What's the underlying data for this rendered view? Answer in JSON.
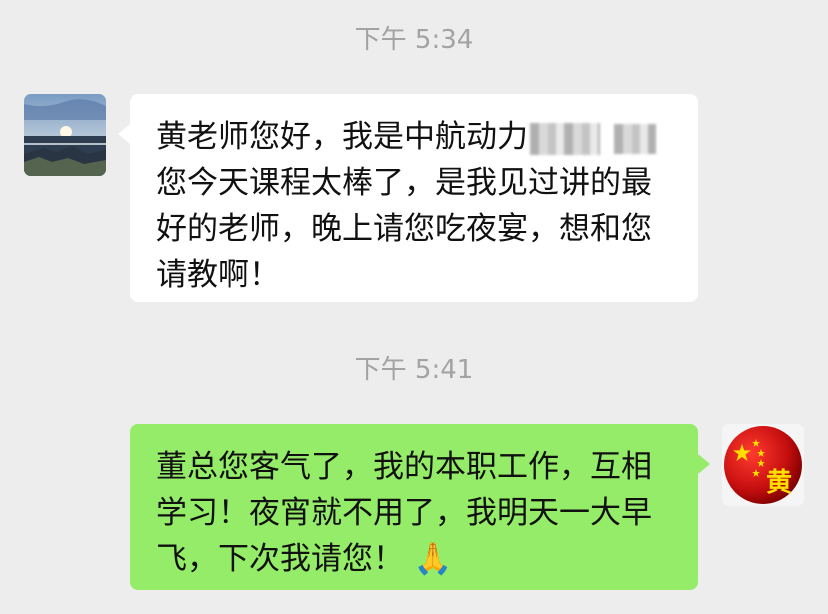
{
  "conversation": {
    "timestamps": [
      "下午 5:34",
      "下午 5:41"
    ],
    "incoming": {
      "text_part1": "黄老师您好，我是中航动力",
      "text_part2": "您今天课程太棒了，是我见过讲的最好的老师，晚上请您吃夜宴，想和您请教啊！"
    },
    "outgoing": {
      "text": "董总您客气了，我的本职工作，互相学习！夜宵就不用了，我明天一大早飞，下次我请您！",
      "emoji": "🙏"
    }
  },
  "contact_avatar": {
    "icon": "seascape-sunset-photo-icon"
  },
  "user_avatar": {
    "icon": "chinese-flag-ball-icon",
    "label": "黄"
  }
}
